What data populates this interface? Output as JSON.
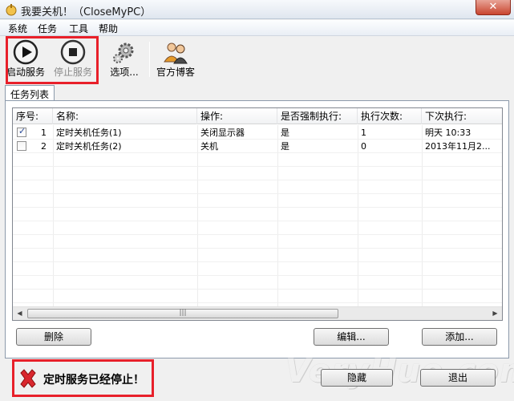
{
  "window": {
    "title": "我要关机！（CloseMyPC）",
    "close_label": "✕"
  },
  "menu": [
    "系统",
    "任务",
    "工具",
    "帮助"
  ],
  "toolbar": {
    "start": "启动服务",
    "stop": "停止服务",
    "options": "选项...",
    "blog": "官方博客"
  },
  "tab": "任务列表",
  "table": {
    "headers": [
      "序号:",
      "名称:",
      "操作:",
      "是否强制执行:",
      "执行次数:",
      "下次执行:"
    ],
    "rows": [
      {
        "checked": true,
        "index": "1",
        "name": "定时关机任务(1)",
        "action": "关闭显示器",
        "force": "是",
        "count": "1",
        "next": "明天 10:33"
      },
      {
        "checked": false,
        "index": "2",
        "name": "定时关机任务(2)",
        "action": "关机",
        "force": "是",
        "count": "0",
        "next": "2013年11月2..."
      }
    ]
  },
  "buttons": {
    "delete": "删除",
    "edit": "编辑...",
    "add": "添加...",
    "hide": "隐藏",
    "exit": "退出"
  },
  "status": "定时服务已经停止！",
  "watermark": "VeryHuo.com",
  "colors": {
    "highlight": "#e8202a",
    "status_icon": "#d9272e"
  }
}
